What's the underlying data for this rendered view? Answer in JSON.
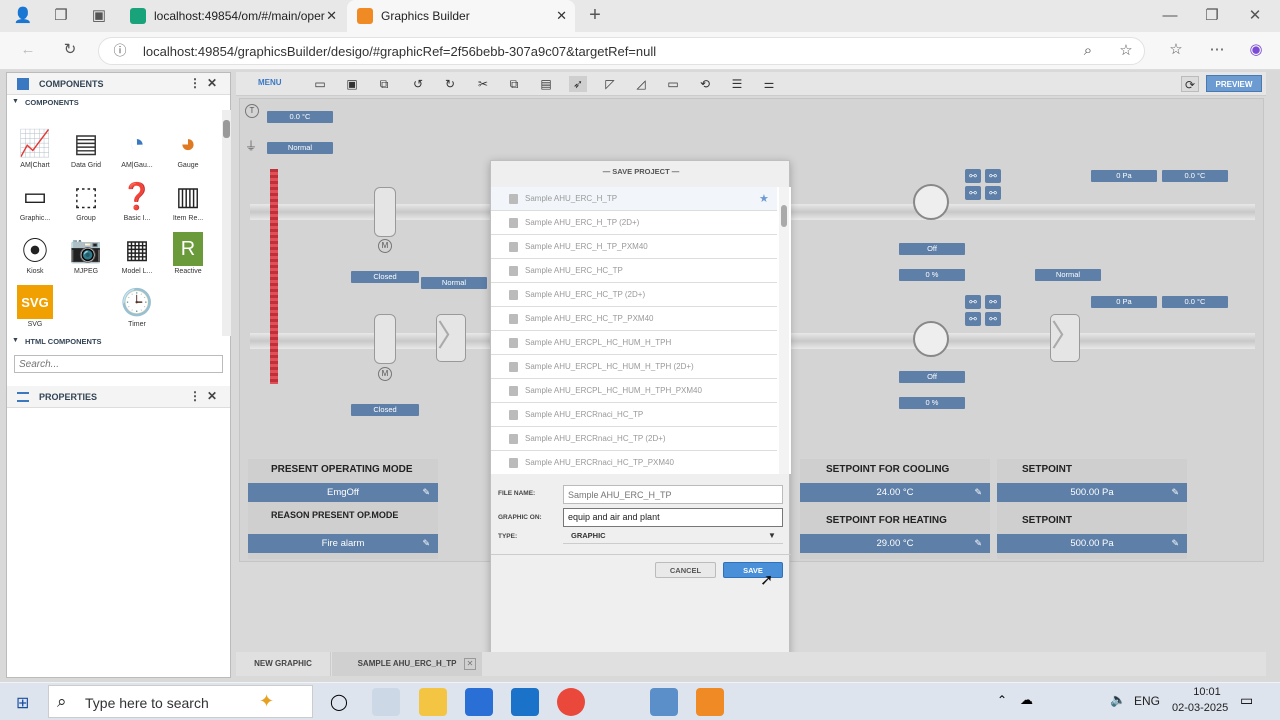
{
  "browser": {
    "tabs": [
      {
        "label": "localhost:49854/om/#/main/oper"
      },
      {
        "label": "Graphics Builder"
      }
    ],
    "url": "localhost:49854/graphicsBuilder/desigo/#graphicRef=2f56bebb-307a9c07&targetRef=null"
  },
  "left_panel": {
    "title": "COMPONENTS",
    "section_components": "COMPONENTS",
    "components": [
      {
        "label": "AM|Chart",
        "icon": "chart-icon"
      },
      {
        "label": "Data Grid",
        "icon": "grid-icon"
      },
      {
        "label": "AM|Gau...",
        "icon": "gauge-icon"
      },
      {
        "label": "Gauge",
        "icon": "gauge-color-icon"
      },
      {
        "label": "Graphic...",
        "icon": "graphic-icon"
      },
      {
        "label": "Group",
        "icon": "group-icon"
      },
      {
        "label": "Basic I...",
        "icon": "help-icon"
      },
      {
        "label": "Item Re...",
        "icon": "item-icon"
      },
      {
        "label": "Kiosk",
        "icon": "kiosk-icon"
      },
      {
        "label": "MJPEG",
        "icon": "camera-icon"
      },
      {
        "label": "Model L...",
        "icon": "model-icon"
      },
      {
        "label": "Reactive",
        "icon": "reactive-icon"
      },
      {
        "label": "SVG",
        "icon": "svg-icon"
      },
      {
        "label": "Timer",
        "icon": "clock-icon"
      }
    ],
    "section_html": "HTML COMPONENTS",
    "search_placeholder": "Search...",
    "properties_title": "PROPERTIES"
  },
  "toolbar": {
    "menu_label": "MENU",
    "preview_label": "PREVIEW"
  },
  "canvas": {
    "stat_00c_a": "0.0 °C",
    "stat_normal_a": "Normal",
    "stat_closed_a": "Closed",
    "stat_normal_b": "Normal",
    "stat_closed_b": "Closed",
    "stat_off_a": "Off",
    "stat_0pct_a": "0 %",
    "stat_off_b": "Off",
    "stat_0pct_b": "0 %",
    "stat_0pa_a": "0 Pa",
    "stat_00c_b": "0.0 °C",
    "stat_normal_c": "Normal",
    "stat_0pa_b": "0 Pa",
    "stat_00c_c": "0.0 °C",
    "m_label": "M",
    "p_label": "P",
    "t_label": "T",
    "panels": {
      "operating_mode_title": "PRESENT OPERATING MODE",
      "operating_mode_value": "EmgOff",
      "reason_title": "REASON PRESENT OP.MODE",
      "reason_value": "Fire alarm",
      "cooling_title": "SETPOINT FOR COOLING",
      "cooling_value": "24.00 °C",
      "heating_title": "SETPOINT FOR HEATING",
      "heating_value": "29.00 °C",
      "setpoint1_title": "SETPOINT",
      "setpoint1_value": "500.00 Pa",
      "setpoint2_title": "SETPOINT",
      "setpoint2_value": "500.00 Pa"
    }
  },
  "dialog": {
    "title": "— SAVE PROJECT —",
    "projects": [
      "Sample AHU_ERC_H_TP",
      "Sample AHU_ERC_H_TP (2D+)",
      "Sample AHU_ERC_H_TP_PXM40",
      "Sample AHU_ERC_HC_TP",
      "Sample AHU_ERC_HC_TP (2D+)",
      "Sample AHU_ERC_HC_TP_PXM40",
      "Sample AHU_ERCPL_HC_HUM_H_TPH",
      "Sample AHU_ERCPL_HC_HUM_H_TPH (2D+)",
      "Sample AHU_ERCPL_HC_HUM_H_TPH_PXM40",
      "Sample AHU_ERCRnaci_HC_TP",
      "Sample AHU_ERCRnaci_HC_TP (2D+)",
      "Sample AHU_ERCRnaci_HC_TP_PXM40"
    ],
    "file_name_label": "FILE NAME:",
    "file_name_placeholder": "Sample AHU_ERC_H_TP",
    "graphic_on_label": "GRAPHIC ON:",
    "graphic_on_value": "equip and air and plant",
    "type_label": "TYPE:",
    "type_value": "GRAPHIC",
    "cancel_label": "CANCEL",
    "save_label": "SAVE"
  },
  "bottom_tabs": [
    {
      "label": "NEW GRAPHIC"
    },
    {
      "label": "SAMPLE AHU_ERC_H_TP"
    }
  ],
  "taskbar": {
    "search_placeholder": "Type here to search",
    "language": "ENG",
    "time": "10:01",
    "date": "02-03-2025"
  },
  "colors": {
    "accent": "#5d7fa8",
    "save_button": "#4a90d9",
    "alarm_red": "#d9262e"
  }
}
